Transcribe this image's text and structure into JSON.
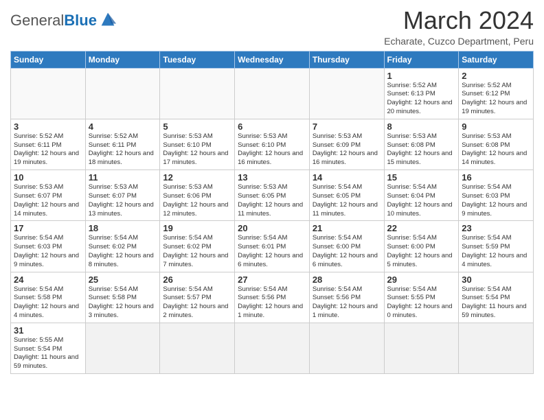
{
  "header": {
    "logo_general": "General",
    "logo_blue": "Blue",
    "month_year": "March 2024",
    "location": "Echarate, Cuzco Department, Peru"
  },
  "weekdays": [
    "Sunday",
    "Monday",
    "Tuesday",
    "Wednesday",
    "Thursday",
    "Friday",
    "Saturday"
  ],
  "weeks": [
    [
      {
        "day": "",
        "info": ""
      },
      {
        "day": "",
        "info": ""
      },
      {
        "day": "",
        "info": ""
      },
      {
        "day": "",
        "info": ""
      },
      {
        "day": "",
        "info": ""
      },
      {
        "day": "1",
        "info": "Sunrise: 5:52 AM\nSunset: 6:13 PM\nDaylight: 12 hours\nand 20 minutes."
      },
      {
        "day": "2",
        "info": "Sunrise: 5:52 AM\nSunset: 6:12 PM\nDaylight: 12 hours\nand 19 minutes."
      }
    ],
    [
      {
        "day": "3",
        "info": "Sunrise: 5:52 AM\nSunset: 6:11 PM\nDaylight: 12 hours\nand 19 minutes."
      },
      {
        "day": "4",
        "info": "Sunrise: 5:52 AM\nSunset: 6:11 PM\nDaylight: 12 hours\nand 18 minutes."
      },
      {
        "day": "5",
        "info": "Sunrise: 5:53 AM\nSunset: 6:10 PM\nDaylight: 12 hours\nand 17 minutes."
      },
      {
        "day": "6",
        "info": "Sunrise: 5:53 AM\nSunset: 6:10 PM\nDaylight: 12 hours\nand 16 minutes."
      },
      {
        "day": "7",
        "info": "Sunrise: 5:53 AM\nSunset: 6:09 PM\nDaylight: 12 hours\nand 16 minutes."
      },
      {
        "day": "8",
        "info": "Sunrise: 5:53 AM\nSunset: 6:08 PM\nDaylight: 12 hours\nand 15 minutes."
      },
      {
        "day": "9",
        "info": "Sunrise: 5:53 AM\nSunset: 6:08 PM\nDaylight: 12 hours\nand 14 minutes."
      }
    ],
    [
      {
        "day": "10",
        "info": "Sunrise: 5:53 AM\nSunset: 6:07 PM\nDaylight: 12 hours\nand 14 minutes."
      },
      {
        "day": "11",
        "info": "Sunrise: 5:53 AM\nSunset: 6:07 PM\nDaylight: 12 hours\nand 13 minutes."
      },
      {
        "day": "12",
        "info": "Sunrise: 5:53 AM\nSunset: 6:06 PM\nDaylight: 12 hours\nand 12 minutes."
      },
      {
        "day": "13",
        "info": "Sunrise: 5:53 AM\nSunset: 6:05 PM\nDaylight: 12 hours\nand 11 minutes."
      },
      {
        "day": "14",
        "info": "Sunrise: 5:54 AM\nSunset: 6:05 PM\nDaylight: 12 hours\nand 11 minutes."
      },
      {
        "day": "15",
        "info": "Sunrise: 5:54 AM\nSunset: 6:04 PM\nDaylight: 12 hours\nand 10 minutes."
      },
      {
        "day": "16",
        "info": "Sunrise: 5:54 AM\nSunset: 6:03 PM\nDaylight: 12 hours\nand 9 minutes."
      }
    ],
    [
      {
        "day": "17",
        "info": "Sunrise: 5:54 AM\nSunset: 6:03 PM\nDaylight: 12 hours\nand 9 minutes."
      },
      {
        "day": "18",
        "info": "Sunrise: 5:54 AM\nSunset: 6:02 PM\nDaylight: 12 hours\nand 8 minutes."
      },
      {
        "day": "19",
        "info": "Sunrise: 5:54 AM\nSunset: 6:02 PM\nDaylight: 12 hours\nand 7 minutes."
      },
      {
        "day": "20",
        "info": "Sunrise: 5:54 AM\nSunset: 6:01 PM\nDaylight: 12 hours\nand 6 minutes."
      },
      {
        "day": "21",
        "info": "Sunrise: 5:54 AM\nSunset: 6:00 PM\nDaylight: 12 hours\nand 6 minutes."
      },
      {
        "day": "22",
        "info": "Sunrise: 5:54 AM\nSunset: 6:00 PM\nDaylight: 12 hours\nand 5 minutes."
      },
      {
        "day": "23",
        "info": "Sunrise: 5:54 AM\nSunset: 5:59 PM\nDaylight: 12 hours\nand 4 minutes."
      }
    ],
    [
      {
        "day": "24",
        "info": "Sunrise: 5:54 AM\nSunset: 5:58 PM\nDaylight: 12 hours\nand 4 minutes."
      },
      {
        "day": "25",
        "info": "Sunrise: 5:54 AM\nSunset: 5:58 PM\nDaylight: 12 hours\nand 3 minutes."
      },
      {
        "day": "26",
        "info": "Sunrise: 5:54 AM\nSunset: 5:57 PM\nDaylight: 12 hours\nand 2 minutes."
      },
      {
        "day": "27",
        "info": "Sunrise: 5:54 AM\nSunset: 5:56 PM\nDaylight: 12 hours\nand 1 minute."
      },
      {
        "day": "28",
        "info": "Sunrise: 5:54 AM\nSunset: 5:56 PM\nDaylight: 12 hours\nand 1 minute."
      },
      {
        "day": "29",
        "info": "Sunrise: 5:54 AM\nSunset: 5:55 PM\nDaylight: 12 hours\nand 0 minutes."
      },
      {
        "day": "30",
        "info": "Sunrise: 5:54 AM\nSunset: 5:54 PM\nDaylight: 11 hours\nand 59 minutes."
      }
    ],
    [
      {
        "day": "31",
        "info": "Sunrise: 5:55 AM\nSunset: 5:54 PM\nDaylight: 11 hours\nand 59 minutes."
      },
      {
        "day": "",
        "info": ""
      },
      {
        "day": "",
        "info": ""
      },
      {
        "day": "",
        "info": ""
      },
      {
        "day": "",
        "info": ""
      },
      {
        "day": "",
        "info": ""
      },
      {
        "day": "",
        "info": ""
      }
    ]
  ]
}
